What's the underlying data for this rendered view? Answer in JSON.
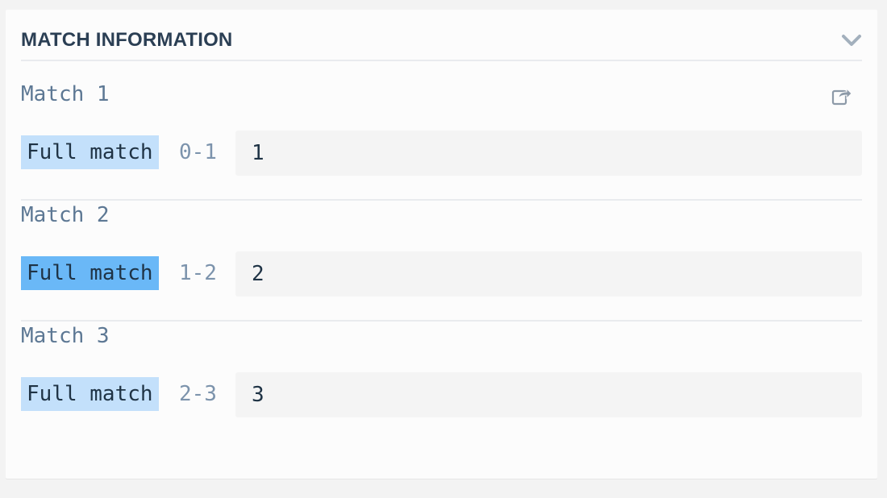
{
  "header": {
    "title": "MATCH INFORMATION",
    "collapse_icon": "chevron-down-icon"
  },
  "share_icon": "share-icon",
  "colors": {
    "group_highlight": "#c3e0fb",
    "group_highlight_active": "#6ab8f7",
    "title_text": "#2b3f54",
    "match_title_text": "#5d7894"
  },
  "matches": [
    {
      "title": "Match 1",
      "group": "Full match",
      "range": "0-1",
      "value": "1",
      "active": false
    },
    {
      "title": "Match 2",
      "group": "Full match",
      "range": "1-2",
      "value": "2",
      "active": true
    },
    {
      "title": "Match 3",
      "group": "Full match",
      "range": "2-3",
      "value": "3",
      "active": false
    }
  ]
}
